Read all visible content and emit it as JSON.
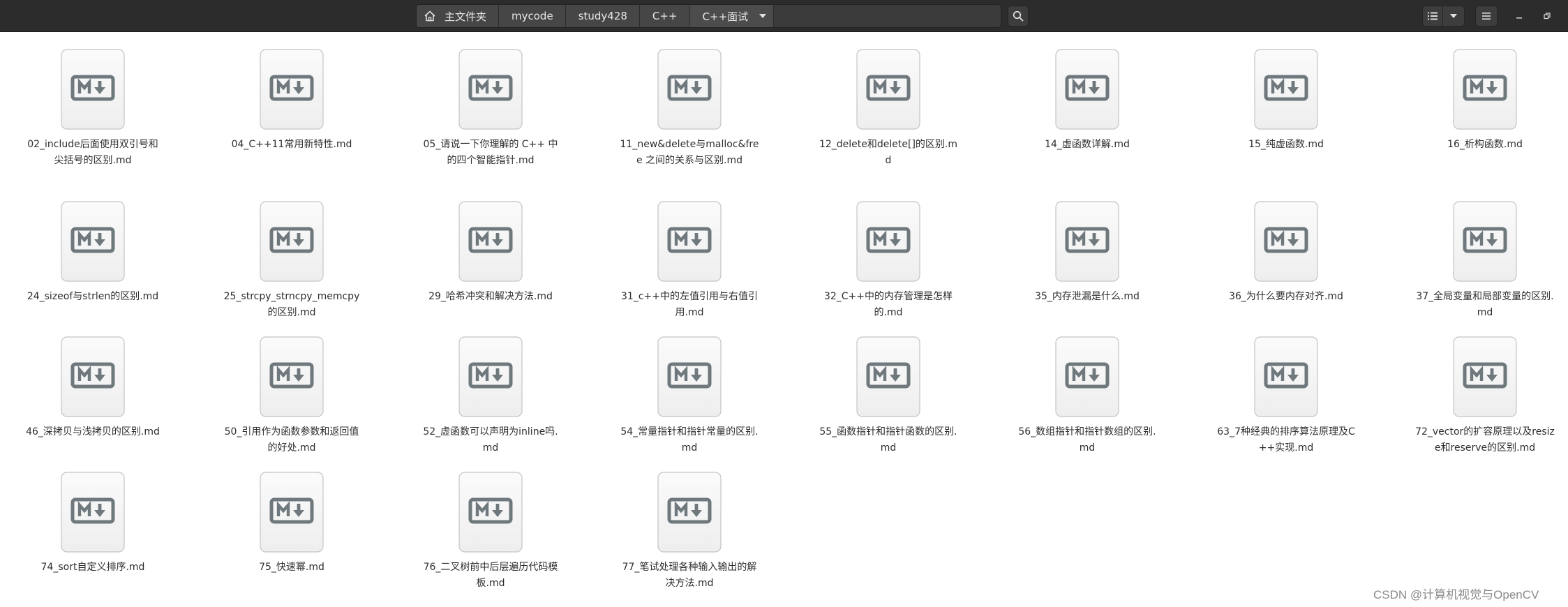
{
  "breadcrumb": {
    "home": "主文件夹",
    "segments": [
      "mycode",
      "study428",
      "C++"
    ],
    "current": "C++面试"
  },
  "colors": {
    "headerbar": "#2c2c2c",
    "pathbar": "#3b3b3b",
    "icon_stroke": "#6f787d",
    "text": "#2e2e2e"
  },
  "icons": {
    "home": "home-icon",
    "search": "search-icon",
    "view_list": "list-view-icon",
    "view_options": "chevron-down-icon",
    "menu": "hamburger-menu-icon",
    "minimize": "minimize-icon",
    "restore": "restore-icon",
    "file": "markdown-file-icon"
  },
  "files": [
    "02_include后面使用双引号和尖括号的区别.md",
    "04_C++11常用新特性.md",
    "05_请说一下你理解的 C++ 中的四个智能指针.md",
    "11_new&delete与malloc&free 之间的关系与区别.md",
    "12_delete和delete[]的区别.md",
    "14_虚函数详解.md",
    "15_纯虚函数.md",
    "16_析构函数.md",
    "24_sizeof与strlen的区别.md",
    "25_strcpy_strncpy_memcpy的区别.md",
    "29_哈希冲突和解决方法.md",
    "31_c++中的左值引用与右值引用.md",
    "32_C++中的内存管理是怎样的.md",
    "35_内存泄漏是什么.md",
    "36_为什么要内存对齐.md",
    "37_全局变量和局部变量的区别.md",
    "46_深拷贝与浅拷贝的区别.md",
    "50_引用作为函数参数和返回值的好处.md",
    "52_虚函数可以声明为inline吗.md",
    "54_常量指针和指针常量的区别.md",
    "55_函数指针和指针函数的区别.md",
    "56_数组指针和指针数组的区别.md",
    "63_7种经典的排序算法原理及C++实现.md",
    "72_vector的扩容原理以及resize和reserve的区别.md",
    "74_sort自定义排序.md",
    "75_快速幂.md",
    "76_二叉树前中后层遍历代码模板.md",
    "77_笔试处理各种输入输出的解决方法.md"
  ],
  "watermark": "CSDN @计算机视觉与OpenCV"
}
